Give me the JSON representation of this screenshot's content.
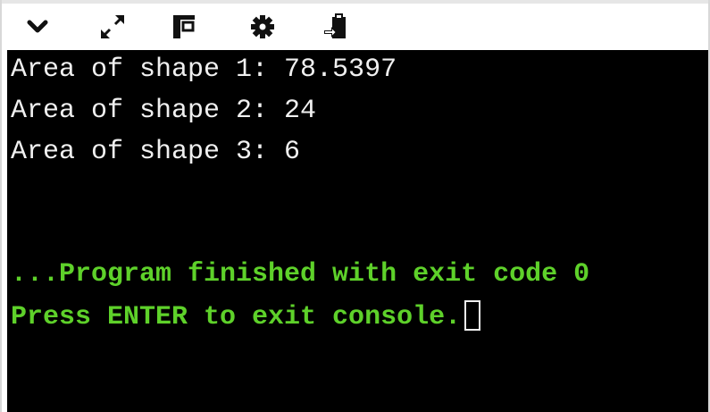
{
  "toolbar": {
    "buttons": [
      {
        "name": "collapse",
        "icon": "chevron-down-icon"
      },
      {
        "name": "expand",
        "icon": "expand-arrows-icon"
      },
      {
        "name": "layout",
        "icon": "panel-layout-icon"
      },
      {
        "name": "settings",
        "icon": "gear-icon"
      },
      {
        "name": "paste",
        "icon": "clipboard-paste-icon"
      }
    ]
  },
  "console": {
    "output_lines": [
      "Area of shape 1: 78.5397",
      "Area of shape 2: 24",
      "Area of shape 3: 6"
    ],
    "exit_message": "...Program finished with exit code 0",
    "prompt": "Press ENTER to exit console.",
    "colors": {
      "background": "#000000",
      "output_text": "#f0f0f0",
      "message_text": "#5ed12a"
    }
  }
}
